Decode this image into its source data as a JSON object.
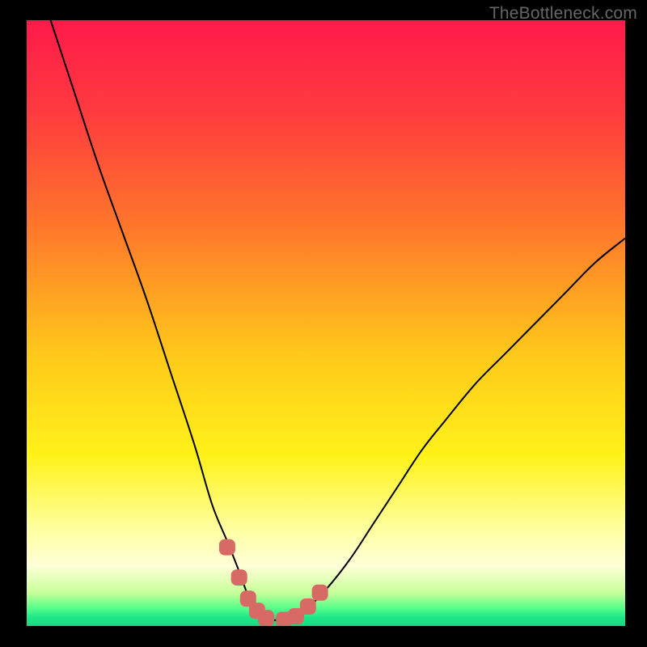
{
  "watermark": "TheBottleneck.com",
  "chart_data": {
    "type": "line",
    "title": "",
    "xlabel": "",
    "ylabel": "",
    "xlim": [
      0,
      100
    ],
    "ylim": [
      0,
      100
    ],
    "background": {
      "type": "vertical-gradient",
      "stops": [
        {
          "offset": 0.0,
          "color": "#ff1a4a"
        },
        {
          "offset": 0.15,
          "color": "#ff3a3f"
        },
        {
          "offset": 0.35,
          "color": "#ff7a2a"
        },
        {
          "offset": 0.55,
          "color": "#ffc81a"
        },
        {
          "offset": 0.72,
          "color": "#fff21a"
        },
        {
          "offset": 0.84,
          "color": "#ffffa0"
        },
        {
          "offset": 0.9,
          "color": "#ffffd8"
        },
        {
          "offset": 0.945,
          "color": "#c8ff9a"
        },
        {
          "offset": 0.97,
          "color": "#5aff8a"
        },
        {
          "offset": 0.985,
          "color": "#20e888"
        },
        {
          "offset": 1.0,
          "color": "#16d982"
        }
      ]
    },
    "series": [
      {
        "name": "bottleneck-curve",
        "color": "#000000",
        "x": [
          4,
          8,
          12,
          16,
          20,
          24,
          28,
          31,
          33.5,
          35.5,
          37,
          38.5,
          40,
          43,
          45,
          47,
          50,
          54,
          58,
          62,
          66,
          70,
          75,
          80,
          85,
          90,
          95,
          100
        ],
        "y": [
          100,
          88,
          76,
          65,
          54,
          42,
          30,
          20,
          14,
          9,
          5,
          2.5,
          1.2,
          1.0,
          1.5,
          3,
          6,
          11,
          17,
          23,
          29,
          34,
          40,
          45,
          50,
          55,
          60,
          64
        ]
      },
      {
        "name": "highlight-markers",
        "color": "#d86a66",
        "type": "scatter",
        "marker_size": 10,
        "x": [
          33.5,
          35.5,
          37,
          38.5,
          40,
          43,
          45,
          47,
          49
        ],
        "y": [
          13,
          8,
          4.5,
          2.5,
          1.3,
          1.0,
          1.6,
          3.2,
          5.5
        ]
      }
    ]
  }
}
